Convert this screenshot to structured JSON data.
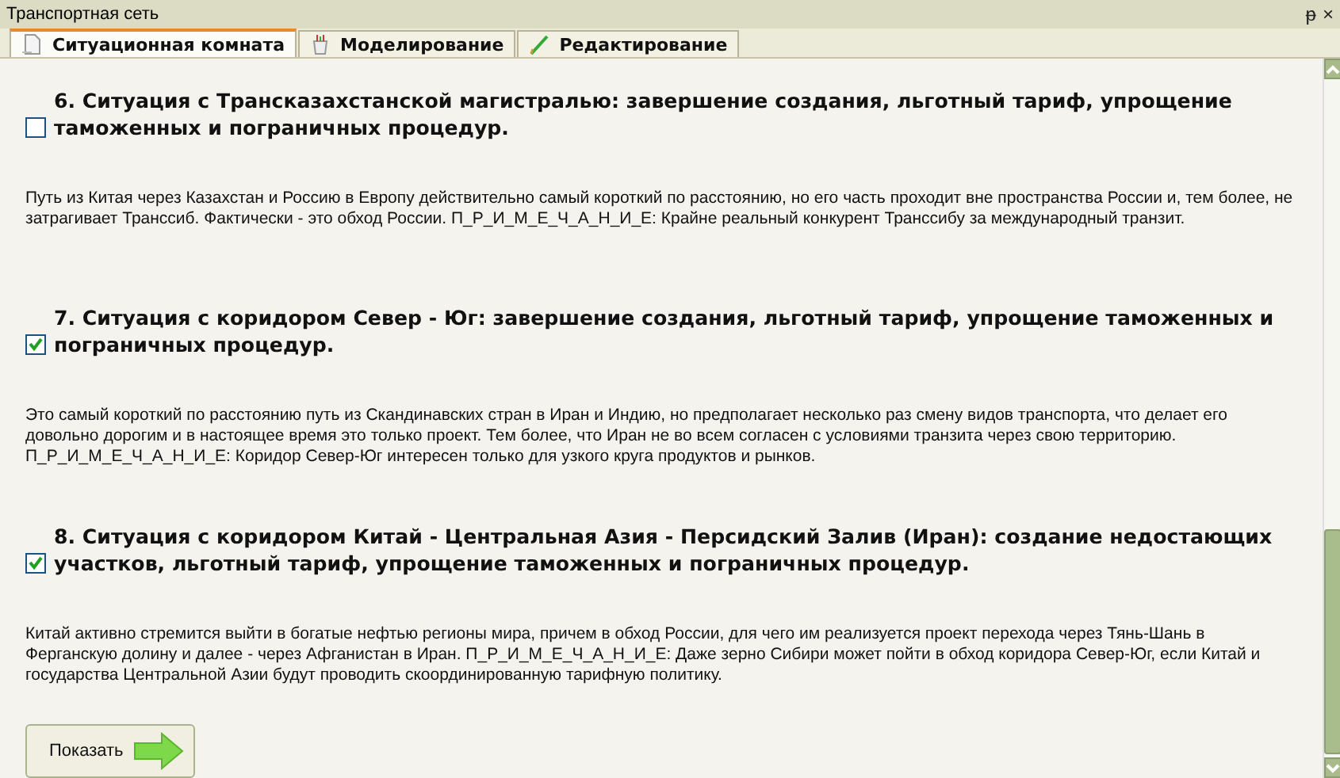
{
  "window": {
    "title": "Транспортная сеть",
    "pin_icon": "ᵽ",
    "close_icon": "×"
  },
  "tabs": [
    {
      "label": "Ситуационная комната",
      "selected": true
    },
    {
      "label": "Моделирование",
      "selected": false
    },
    {
      "label": "Редактирование",
      "selected": false
    }
  ],
  "situations": [
    {
      "title": "6. Ситуация с  Трансказахстанской магистралью: завершение создания,  льготный тариф, упрощение таможенных и пограничных процедур.",
      "checked": false,
      "description": "Путь из Китая через Казахстан и Россию в Европу действительно самый короткий по расстоянию, но его часть проходит вне пространства России и, тем более, не затрагивает Транссиб. Фактически - это обход России. П_Р_И_М_Е_Ч_А_Н_И_Е: Крайне реальный конкурент Транссибу за международный транзит."
    },
    {
      "title": "7. Ситуация с коридором Север - Юг: завершение создания,  льготный тариф, упрощение таможенных и пограничных процедур.",
      "checked": true,
      "description": "Это самый короткий по расстоянию путь из Скандинавских стран в Иран и Индию, но предполагает несколько раз смену видов транспорта, что делает его довольно дорогим и в настоящее время это только проект. Тем более, что Иран не во всем согласен с условиями транзита через свою территорию. П_Р_И_М_Е_Ч_А_Н_И_Е: Коридор Север-Юг интересен только для узкого круга продуктов и рынков."
    },
    {
      "title": "8. Ситуация с коридором Китай - Центральная Азия - Персидский Залив (Иран): создание недостающих участков, льготный тариф, упрощение таможенных и пограничных процедур.",
      "checked": true,
      "description": "Китай активно стремится выйти в богатые нефтью регионы мира, причем в обход России, для чего им реализуется проект перехода через Тянь-Шань в Ферганскую долину и далее - через Афганистан в Иран. П_Р_И_М_Е_Ч_А_Н_И_Е: Даже зерно Сибири может пойти в обход коридора Север-Юг, если Китай и государства Центральной Азии будут проводить скоординированную тарифную политику."
    }
  ],
  "show_button": {
    "label": "Показать"
  }
}
